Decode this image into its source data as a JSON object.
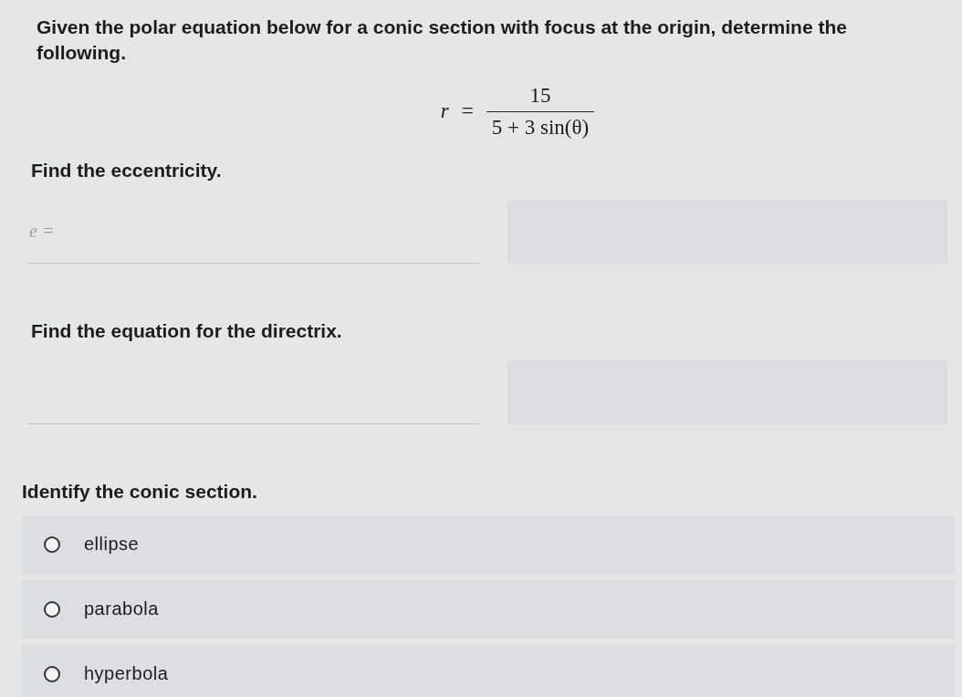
{
  "question": {
    "intro": "Given the polar equation below for a conic section with focus at the origin, determine the following.",
    "equation": {
      "lhs": "r",
      "equals": "=",
      "numerator": "15",
      "denominator": "5 + 3 sin(θ)"
    }
  },
  "parts": [
    {
      "kind": "input",
      "prompt": "Find the eccentricity.",
      "label": "e ="
    },
    {
      "kind": "input",
      "prompt": "Find the equation for the directrix."
    },
    {
      "kind": "choice",
      "prompt": "Identify the conic section.",
      "options": [
        {
          "label": "ellipse",
          "selected": false
        },
        {
          "label": "parabola",
          "selected": false
        },
        {
          "label": "hyperbola",
          "selected": false
        }
      ]
    }
  ]
}
